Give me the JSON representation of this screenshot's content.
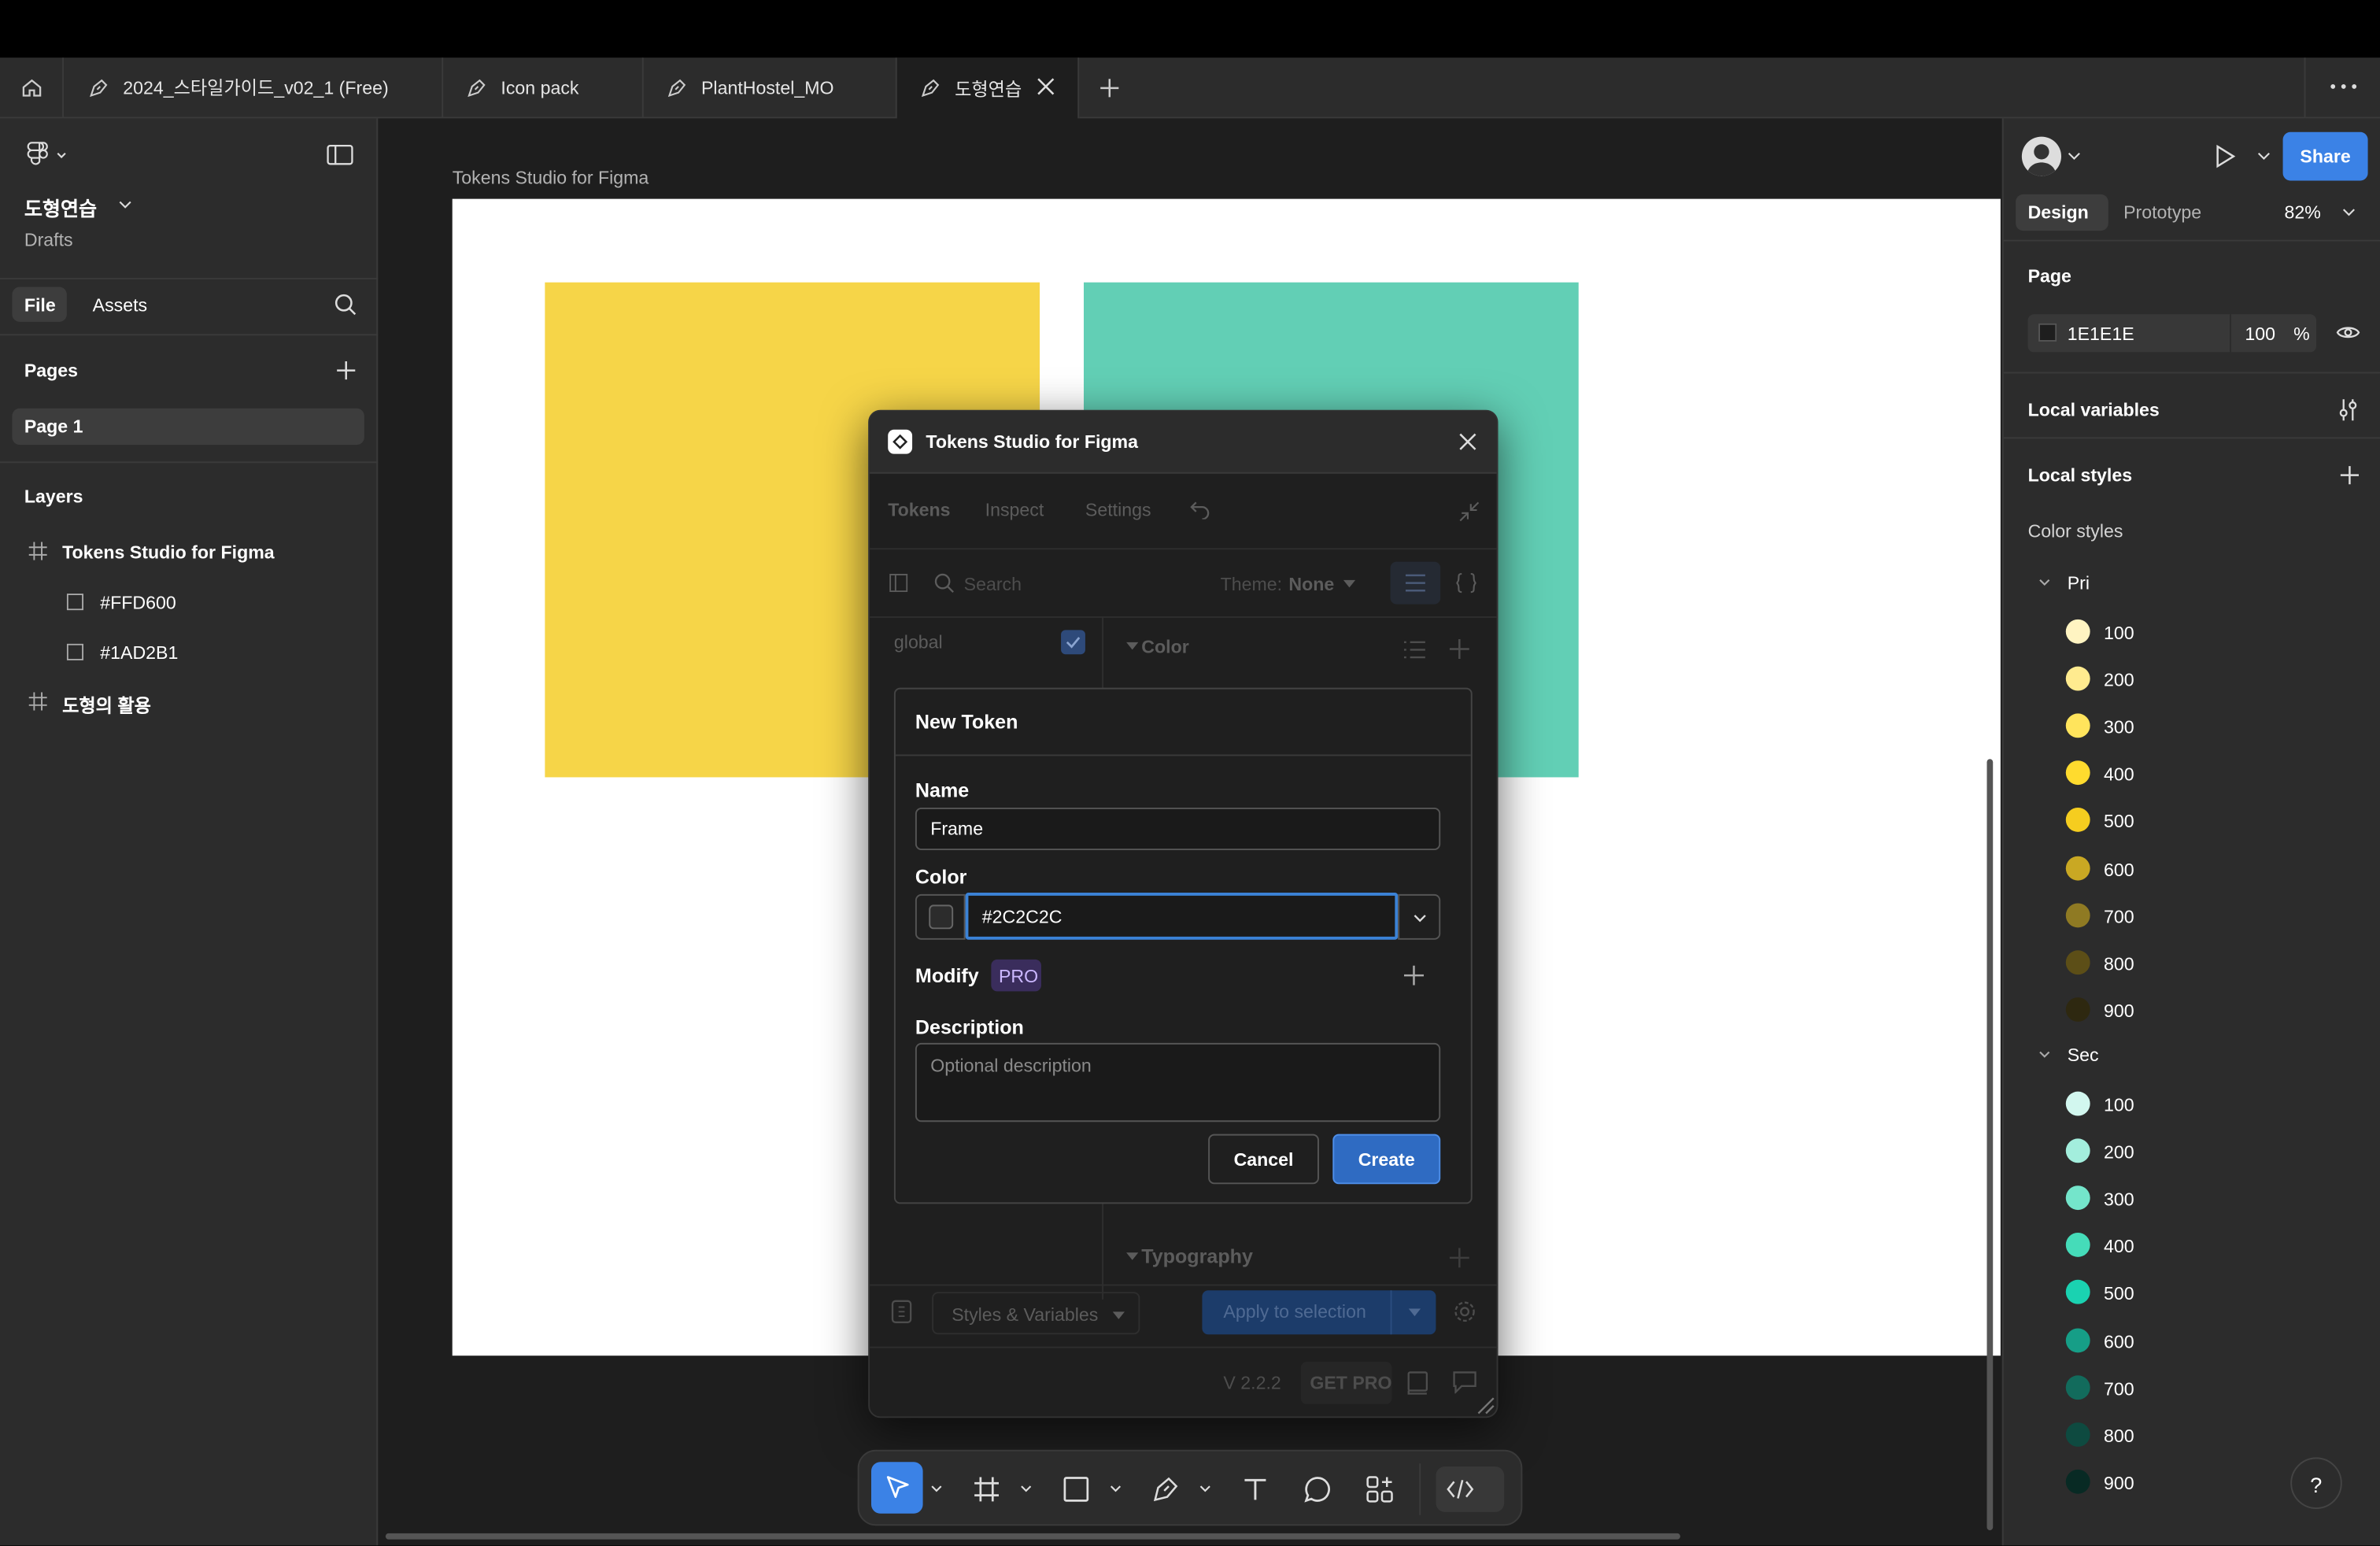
{
  "tabs": [
    {
      "label": "2024_스타일가이드_v02_1 (Free)"
    },
    {
      "label": "Icon pack"
    },
    {
      "label": "PlantHostel_MO"
    },
    {
      "label": "도형연습"
    }
  ],
  "file": {
    "name": "도형연습",
    "location": "Drafts"
  },
  "left_tabs": {
    "file": "File",
    "assets": "Assets"
  },
  "pages": {
    "heading": "Pages",
    "items": [
      "Page 1"
    ]
  },
  "layers": {
    "heading": "Layers",
    "items": [
      "Tokens Studio for Figma",
      "#FFD600",
      "#1AD2B1",
      "도형의 활용"
    ]
  },
  "canvas": {
    "frame_label": "Tokens Studio for Figma"
  },
  "shapes": [
    {
      "name": "#FFD600",
      "color": "#f6d548"
    },
    {
      "name": "#1AD2B1",
      "color": "#62cfb5"
    }
  ],
  "plugin": {
    "title": "Tokens Studio for Figma",
    "nav": [
      "Tokens",
      "Inspect",
      "Settings"
    ],
    "search_placeholder": "Search",
    "theme_label": "Theme:",
    "theme_value": "None",
    "token_sets": [
      "global"
    ],
    "groups": [
      "Color",
      "Typography"
    ],
    "styles_button": "Styles & Variables",
    "apply_button": "Apply to selection",
    "version": "V 2.2.2",
    "get_pro": "GET PRO"
  },
  "new_token": {
    "title": "New Token",
    "name_label": "Name",
    "name_value": "Frame",
    "color_label": "Color",
    "color_value": "#2C2C2C",
    "modify_label": "Modify",
    "pro_badge": "PRO",
    "description_label": "Description",
    "description_placeholder": "Optional description",
    "cancel": "Cancel",
    "create": "Create"
  },
  "right": {
    "share": "Share",
    "design_tab": "Design",
    "prototype_tab": "Prototype",
    "zoom": "82%",
    "page_heading": "Page",
    "page_color": "1E1E1E",
    "page_opacity": "100",
    "percent": "%",
    "local_variables": "Local variables",
    "local_styles": "Local styles",
    "color_styles": "Color styles",
    "groups": [
      {
        "name": "Pri",
        "items": [
          {
            "label": "100",
            "color": "#fff4c2"
          },
          {
            "label": "200",
            "color": "#ffeb8f"
          },
          {
            "label": "300",
            "color": "#ffe45c"
          },
          {
            "label": "400",
            "color": "#ffdb2e"
          },
          {
            "label": "500",
            "color": "#f5cd1f"
          },
          {
            "label": "600",
            "color": "#c9a823"
          },
          {
            "label": "700",
            "color": "#8f7a23"
          },
          {
            "label": "800",
            "color": "#5c4e17"
          },
          {
            "label": "900",
            "color": "#2e2810"
          }
        ]
      },
      {
        "name": "Sec",
        "items": [
          {
            "label": "100",
            "color": "#d2f7ef"
          },
          {
            "label": "200",
            "color": "#a3eedd"
          },
          {
            "label": "300",
            "color": "#74e5cb"
          },
          {
            "label": "400",
            "color": "#45dcb9"
          },
          {
            "label": "500",
            "color": "#1ad2b1"
          },
          {
            "label": "600",
            "color": "#169e87"
          },
          {
            "label": "700",
            "color": "#126b5c"
          },
          {
            "label": "800",
            "color": "#0e4a40"
          },
          {
            "label": "900",
            "color": "#082a24"
          }
        ]
      }
    ]
  },
  "help": "?"
}
